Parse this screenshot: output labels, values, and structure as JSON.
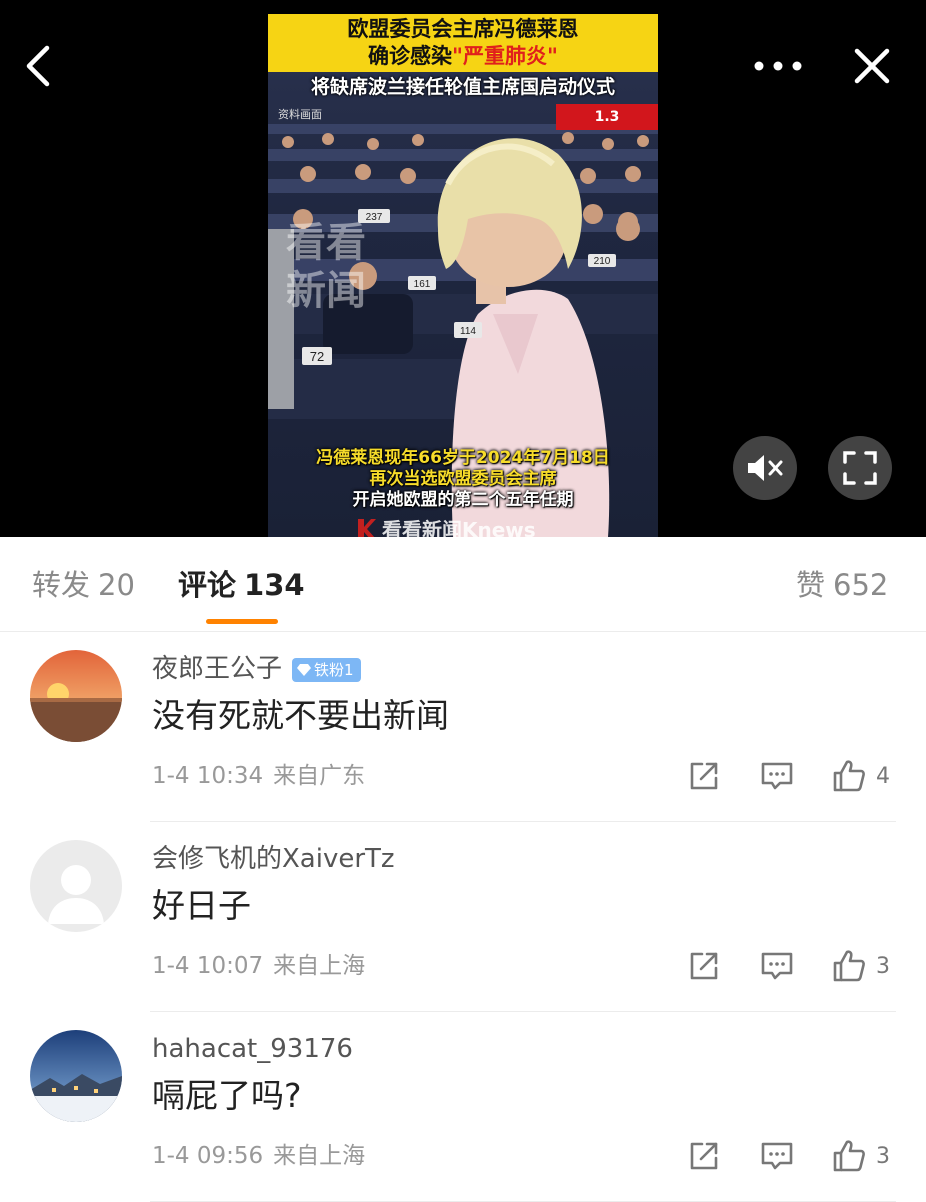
{
  "top_bar": {
    "back_icon": "chevron-left-icon",
    "more_icon": "more-dots-icon",
    "close_icon": "close-icon"
  },
  "video": {
    "title_line1": "欧盟委员会主席冯德莱恩",
    "title_line2_pre": "确诊感染",
    "title_line2_highlight": "\"严重肺炎\"",
    "subtitle": "将缺席波兰接任轮值主席国启动仪式",
    "source_note": "资料画面",
    "page_indicator": "1.3",
    "caption_line1": "冯德莱恩现年66岁于2024年7月18日",
    "caption_line2": "再次当选欧盟委员会主席",
    "caption_line3": "开启她欧盟的第二个五年任期",
    "watermark": "看看新闻",
    "logo_text": "看看新闻Knews",
    "seat_numbers": [
      "237",
      "210",
      "161",
      "114",
      "72"
    ],
    "mute_icon": "volume-mute-icon",
    "fullscreen_icon": "fullscreen-icon",
    "colors": {
      "title_band": "#f6d414",
      "title_highlight": "#e0201c",
      "page_badge": "#d2161c",
      "caption": "#f7dc2a"
    }
  },
  "tabs": {
    "forward_label": "转发",
    "forward_count": "20",
    "comments_label": "评论",
    "comments_count": "134",
    "likes_label": "赞",
    "likes_count": "652",
    "active_color": "#ff8200"
  },
  "comments": [
    {
      "username": "夜郎王公子",
      "badge": "铁粉1",
      "text": "没有死就不要出新闻",
      "time": "1-4 10:34",
      "location": "来自广东",
      "likes": "4"
    },
    {
      "username": "会修飞机的XaiverTz",
      "badge": "",
      "text": "好日子",
      "time": "1-4 10:07",
      "location": "来自上海",
      "likes": "3"
    },
    {
      "username": "hahacat_93176",
      "badge": "",
      "text": "嗝屁了吗?",
      "time": "1-4 09:56",
      "location": "来自上海",
      "likes": "3"
    }
  ]
}
